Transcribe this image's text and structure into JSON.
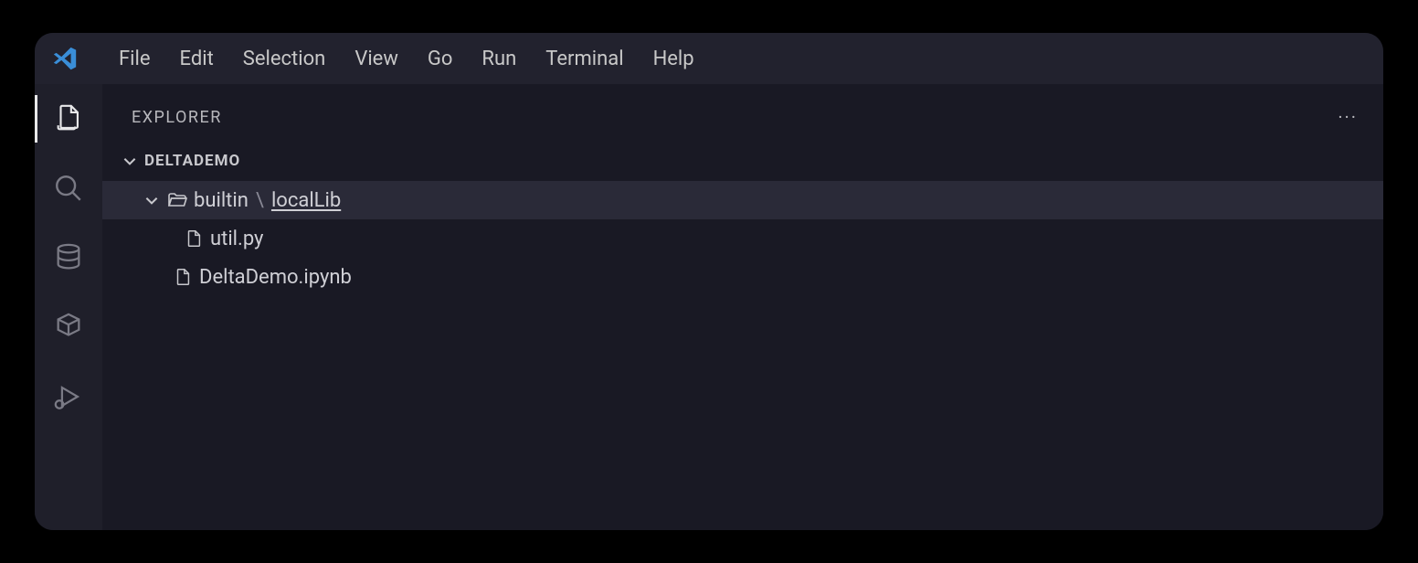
{
  "menubar": {
    "items": [
      "File",
      "Edit",
      "Selection",
      "View",
      "Go",
      "Run",
      "Terminal",
      "Help"
    ]
  },
  "activity_bar": {
    "items": [
      {
        "name": "explorer",
        "icon": "files-icon",
        "active": true
      },
      {
        "name": "search",
        "icon": "search-icon",
        "active": false
      },
      {
        "name": "source-control",
        "icon": "source-control-icon",
        "active": false
      },
      {
        "name": "extensions",
        "icon": "extensions-icon",
        "active": false
      },
      {
        "name": "run-debug",
        "icon": "debug-icon",
        "active": false
      }
    ]
  },
  "panel": {
    "title": "EXPLORER",
    "section_label": "DELTADEMO"
  },
  "tree": {
    "folder_prefix": "builtin",
    "folder_sep": "\\",
    "folder_leaf": "localLib",
    "file_1": "util.py",
    "file_2": "DeltaDemo.ipynb"
  }
}
